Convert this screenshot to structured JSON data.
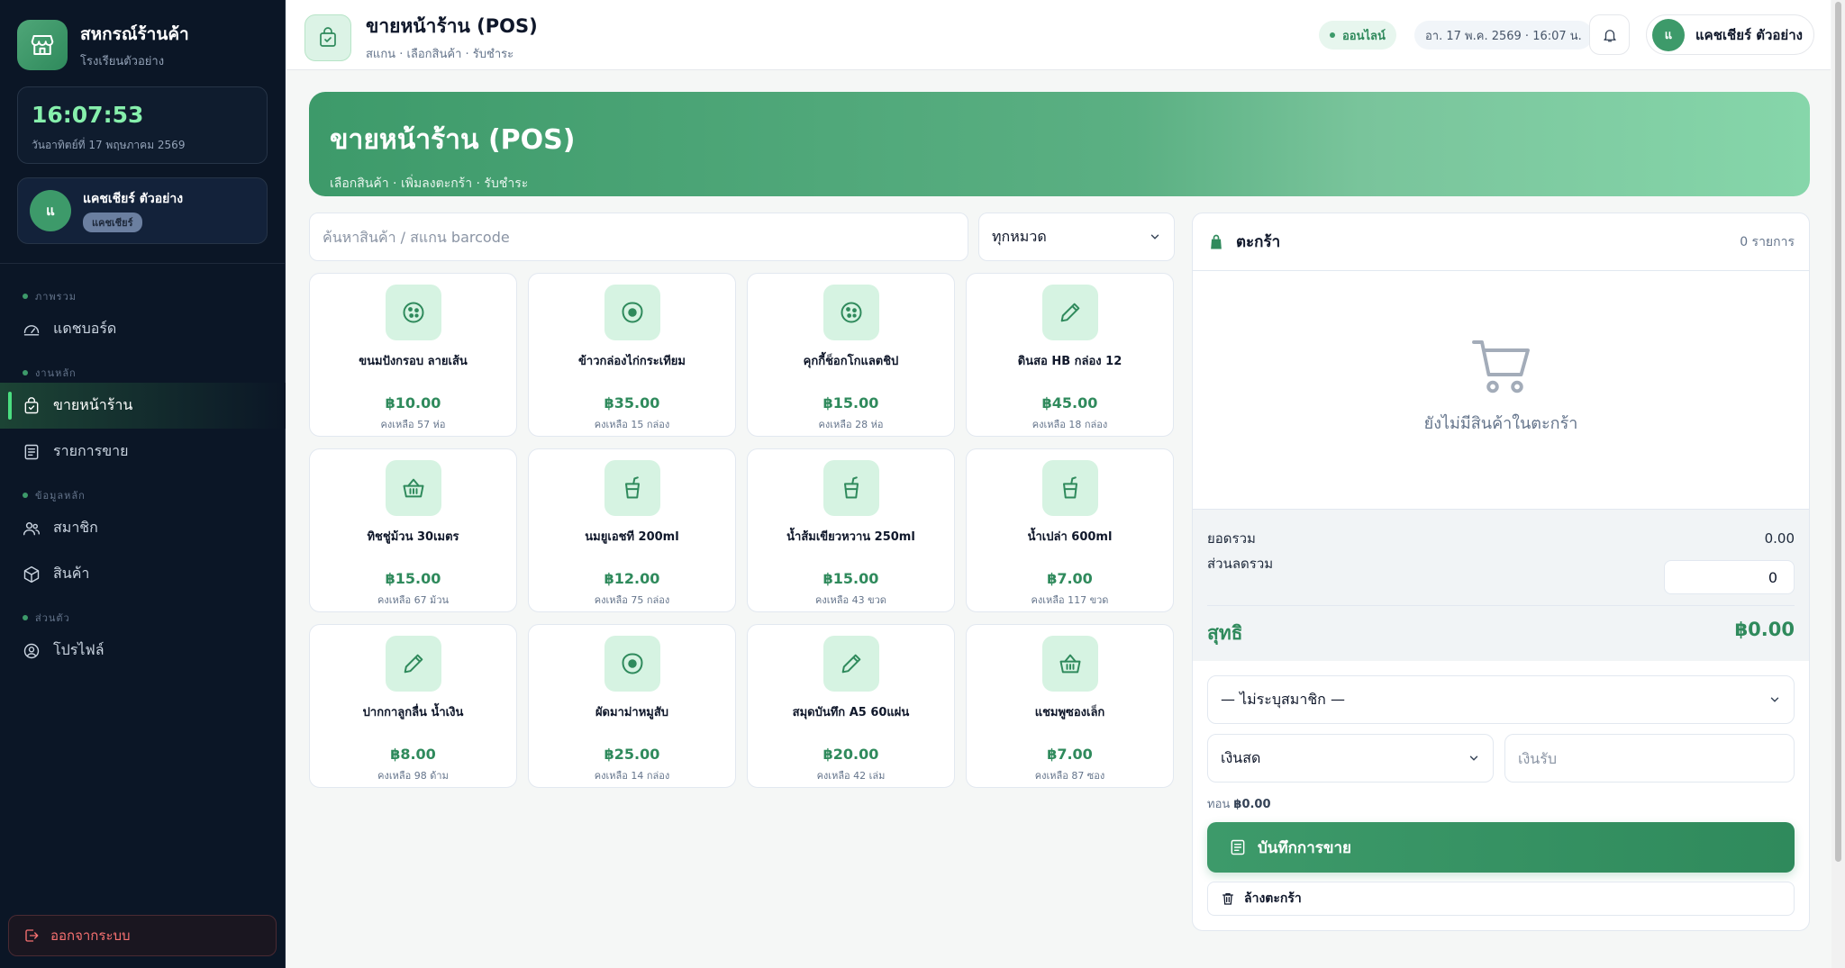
{
  "sidebar": {
    "brand_title": "สหกรณ์ร้านค้า",
    "brand_subtitle": "โรงเรียนตัวอย่าง",
    "clock_time": "16:07:53",
    "clock_date": "วันอาทิตย์ที่ 17 พฤษภาคม 2569",
    "user_initial": "แ",
    "user_name": "แคชเชียร์ ตัวอย่าง",
    "user_role": "แคชเชียร์",
    "groups": [
      {
        "label": "ภาพรวม",
        "items": [
          {
            "label": "แดชบอร์ด"
          }
        ]
      },
      {
        "label": "งานหลัก",
        "items": [
          {
            "label": "ขายหน้าร้าน"
          },
          {
            "label": "รายการขาย"
          }
        ]
      },
      {
        "label": "ข้อมูลหลัก",
        "items": [
          {
            "label": "สมาชิก"
          },
          {
            "label": "สินค้า"
          }
        ]
      },
      {
        "label": "ส่วนตัว",
        "items": [
          {
            "label": "โปรไฟล์"
          }
        ]
      }
    ],
    "logout_label": "ออกจากระบบ"
  },
  "topbar": {
    "title": "ขายหน้าร้าน (POS)",
    "subtitle": "สแกน · เลือกสินค้า · รับชำระ",
    "status": "ออนไลน์",
    "datetime": "อา. 17 พ.ค. 2569 · 16:07 น.",
    "user_initial": "แ",
    "user_name": "แคชเชียร์ ตัวอย่าง"
  },
  "hero": {
    "title": "ขายหน้าร้าน (POS)",
    "subtitle": "เลือกสินค้า · เพิ่มลงตะกร้า · รับชำระ"
  },
  "search": {
    "placeholder": "ค้นหาสินค้า / สแกน barcode",
    "category": "ทุกหมวด"
  },
  "products": [
    {
      "name": "ขนมปังกรอบ ลายเส้น",
      "price": "฿10.00",
      "stock": "คงเหลือ 57 ห่อ",
      "icon": "cookie-icon"
    },
    {
      "name": "ข้าวกล่องไก่กระเทียม",
      "price": "฿35.00",
      "stock": "คงเหลือ 15 กล่อง",
      "icon": "egg-icon"
    },
    {
      "name": "คุกกี้ช็อกโกแลตชิป",
      "price": "฿15.00",
      "stock": "คงเหลือ 28 ห่อ",
      "icon": "cookie-icon"
    },
    {
      "name": "ดินสอ HB กล่อง 12",
      "price": "฿45.00",
      "stock": "คงเหลือ 18 กล่อง",
      "icon": "pencil-icon"
    },
    {
      "name": "ทิชชู่ม้วน 30เมตร",
      "price": "฿15.00",
      "stock": "คงเหลือ 67 ม้วน",
      "icon": "basket-icon"
    },
    {
      "name": "นมยูเอชที 200ml",
      "price": "฿12.00",
      "stock": "คงเหลือ 75 กล่อง",
      "icon": "cup-icon"
    },
    {
      "name": "น้ำส้มเขียวหวาน 250ml",
      "price": "฿15.00",
      "stock": "คงเหลือ 43 ขวด",
      "icon": "cup-icon"
    },
    {
      "name": "น้ำเปล่า 600ml",
      "price": "฿7.00",
      "stock": "คงเหลือ 117 ขวด",
      "icon": "cup-icon"
    },
    {
      "name": "ปากกาลูกลื่น น้ำเงิน",
      "price": "฿8.00",
      "stock": "คงเหลือ 98 ด้าม",
      "icon": "pencil-icon"
    },
    {
      "name": "ผัดมาม่าหมูสับ",
      "price": "฿25.00",
      "stock": "คงเหลือ 14 กล่อง",
      "icon": "egg-icon"
    },
    {
      "name": "สมุดบันทึก A5 60แผ่น",
      "price": "฿20.00",
      "stock": "คงเหลือ 42 เล่ม",
      "icon": "pencil-icon"
    },
    {
      "name": "แชมพูซองเล็ก",
      "price": "฿7.00",
      "stock": "คงเหลือ 87 ซอง",
      "icon": "basket-icon"
    }
  ],
  "cart": {
    "title": "ตะกร้า",
    "count": "0 รายการ",
    "empty_text": "ยังไม่มีสินค้าในตะกร้า",
    "subtotal_label": "ยอดรวม",
    "subtotal_value": "0.00",
    "discount_label": "ส่วนลดรวม",
    "discount_value": "0",
    "net_label": "สุทธิ",
    "net_value": "฿0.00",
    "member_select": "— ไม่ระบุสมาชิก —",
    "payment_select": "เงินสด",
    "received_placeholder": "เงินรับ",
    "change_label": "ทอน",
    "change_value": "฿0.00",
    "save_label": "บันทึกการขาย",
    "clear_label": "ล้างตะกร้า"
  },
  "colors": {
    "accent": "#3d9a6a",
    "sidebar_bg": "#0b1626",
    "price": "#2f8a5c"
  }
}
